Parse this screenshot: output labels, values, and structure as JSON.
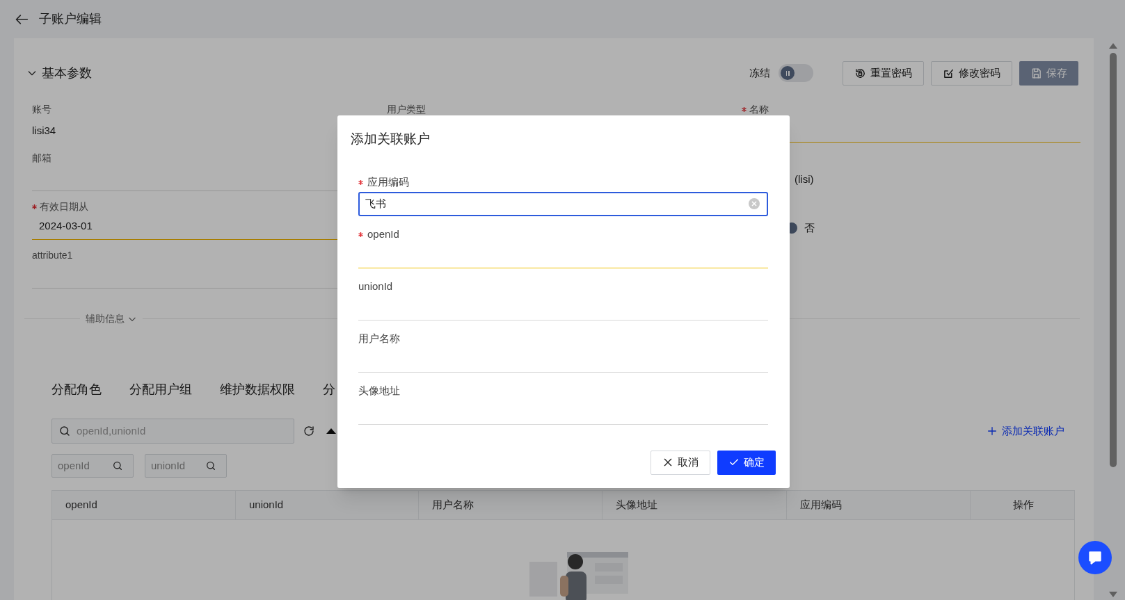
{
  "header": {
    "title": "子账户编辑"
  },
  "section": {
    "title": "基本参数",
    "expanded": true
  },
  "freeze": {
    "label": "冻结",
    "on": false
  },
  "actions": [
    {
      "label": "重置密码",
      "kind": "reset"
    },
    {
      "label": "修改密码",
      "kind": "edit"
    },
    {
      "label": "保存",
      "kind": "save"
    }
  ],
  "form": {
    "column_1": [
      {
        "kind": "text",
        "label": "账号",
        "value": "lisi34",
        "required": false
      },
      {
        "kind": "input",
        "label": "邮箱",
        "required": false
      },
      {
        "kind": "input",
        "label": "有效日期从",
        "value": "2024-03-01",
        "required": true
      },
      {
        "kind": "input",
        "label": "attribute1",
        "required": false
      }
    ],
    "column_2": [
      {
        "kind": "text",
        "label": "用户类型",
        "required": false
      }
    ],
    "column_3": [
      {
        "kind": "input",
        "label": "名称",
        "required": true
      },
      {
        "kind": "fragment",
        "value": "(lisi)"
      },
      {
        "kind": "radio",
        "value": "否",
        "selected": true
      }
    ]
  },
  "divider": {
    "label": "辅助信息",
    "expanded": false
  },
  "tabs": [
    {
      "label": "分配角色",
      "selected": false
    },
    {
      "label": "分配用户组",
      "selected": false
    },
    {
      "label": "维护数据权限",
      "selected": false
    },
    {
      "label": "分",
      "selected": false
    }
  ],
  "search": {
    "placeholder": "openId,unionId"
  },
  "filters": [
    {
      "placeholder": "openId"
    },
    {
      "placeholder": "unionId"
    }
  ],
  "add_link": "添加关联账户",
  "table": {
    "columns": [
      "openId",
      "unionId",
      "用户名称",
      "头像地址",
      "应用编码",
      "操作"
    ]
  },
  "modal": {
    "title": "添加关联账户",
    "fields": [
      {
        "label": "应用编码",
        "required": true,
        "value": "飞书",
        "focused": true
      },
      {
        "label": "openId",
        "required": true,
        "focused": false
      },
      {
        "label": "unionId",
        "required": false,
        "focused": false
      },
      {
        "label": "用户名称",
        "required": false,
        "focused": false
      },
      {
        "label": "头像地址",
        "required": false,
        "focused": false
      }
    ],
    "buttons": [
      {
        "label": "取消",
        "kind": "cancel"
      },
      {
        "label": "确定",
        "kind": "confirm"
      }
    ]
  }
}
